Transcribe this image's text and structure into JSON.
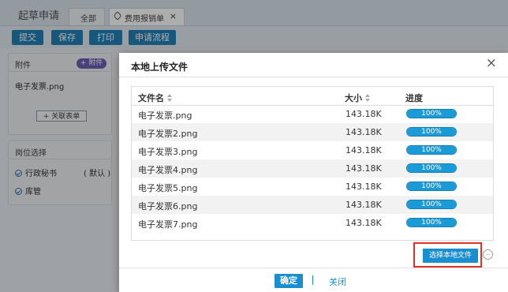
{
  "header": {
    "app_title": "起草申请",
    "tabs": [
      {
        "label": "全部"
      },
      {
        "label": "费用报销单",
        "close": "×"
      }
    ]
  },
  "toolbar": {
    "buttons": [
      "提交",
      "保存",
      "打印",
      "申请流程"
    ]
  },
  "background": {
    "attachments_label": "附件",
    "add_attachment": "+ 附件",
    "file_name": "电子发票.png",
    "link_form": "+ 关联表单",
    "post_select_label": "岗位选择",
    "roles": [
      {
        "label": "行政秘书",
        "tag": "( 默认 )"
      },
      {
        "label": "库管"
      }
    ]
  },
  "dialog": {
    "title": "本地上传文件",
    "close": "×",
    "columns": {
      "name": "文件名",
      "size": "大小",
      "progress": "进度"
    },
    "files": [
      {
        "name": "电子发票.png",
        "size": "143.18K",
        "progress_label": "100%",
        "progress": 1.0
      },
      {
        "name": "电子发票2.png",
        "size": "143.18K",
        "progress_label": "100%",
        "progress": 1.0
      },
      {
        "name": "电子发票3.png",
        "size": "143.18K",
        "progress_label": "100%",
        "progress": 1.0
      },
      {
        "name": "电子发票4.png",
        "size": "143.18K",
        "progress_label": "100%",
        "progress": 1.0
      },
      {
        "name": "电子发票5.png",
        "size": "143.18K",
        "progress_label": "100%",
        "progress": 1.0
      },
      {
        "name": "电子发票6.png",
        "size": "143.18K",
        "progress_label": "100%",
        "progress": 1.0
      },
      {
        "name": "电子发票7.png",
        "size": "143.18K",
        "progress_label": "100%",
        "progress": 1.0
      }
    ],
    "choose_button": "选择本地文件",
    "more_icon": "...",
    "ok_button": "确定",
    "close_link": "关闭"
  },
  "colors": {
    "primary": "#1a8fd0",
    "toolbar_button": "#2480b7",
    "highlight": "#e0312a",
    "progress": "#1a9ad6"
  }
}
